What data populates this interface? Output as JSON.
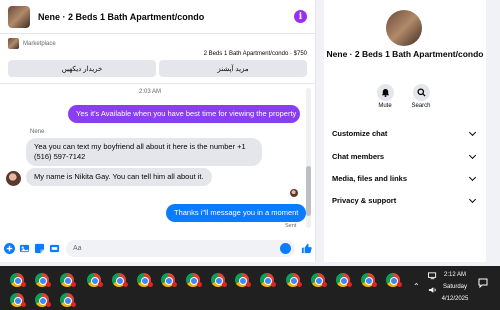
{
  "chat": {
    "title": "Nene · 2 Beds 1 Bath Apartment/condo",
    "info_glyph": "i"
  },
  "marketplace": {
    "label": "Marketplace",
    "listing": "2 Beds 1 Bath Apartment/condo · $750",
    "buttons": [
      "خریدار دیکهیں",
      "مزید آپشنز"
    ]
  },
  "messages": {
    "timestamp": "2:03 AM",
    "outgoing_1": "Yes it's Available when you have best time for viewing the property",
    "sender_name": "Nene",
    "incoming_1": "Yea you can text my boyfriend all about it here is the number +1 (516) 597-7142",
    "incoming_2": "My name is Nikita Gay. You can tell him all about it.",
    "outgoing_2": "Thanks i\"ll message you in a moment",
    "status": "Sent"
  },
  "composer": {
    "placeholder": "Aa"
  },
  "details": {
    "title": "Nene · 2 Beds 1 Bath Apartment/condo",
    "actions": [
      {
        "label": "Mute",
        "icon": "bell-icon"
      },
      {
        "label": "Search",
        "icon": "search-icon"
      }
    ],
    "sections": [
      "Customize chat",
      "Chat members",
      "Media, files and links",
      "Privacy & support"
    ]
  },
  "taskbar": {
    "time": "2:12 AM",
    "day": "Saturday",
    "date": "4/12/2025",
    "app_icon": "chrome-icon",
    "colors": {
      "background": "#202020",
      "badge": "#e02424"
    }
  },
  "colors": {
    "accent_purple": "#8a3ef2",
    "accent_blue": "#0a7cff"
  }
}
